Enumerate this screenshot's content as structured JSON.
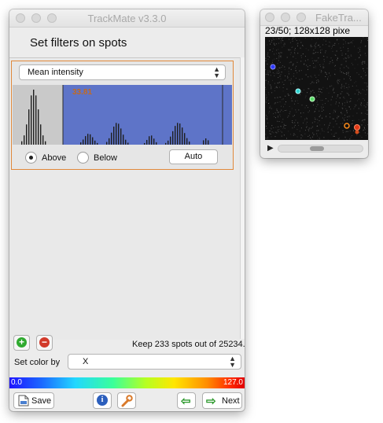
{
  "trackmate": {
    "title": "TrackMate v3.3.0",
    "heading": "Set filters on spots",
    "filter": {
      "feature": "Mean intensity",
      "threshold": "33.81",
      "above_label": "Above",
      "below_label": "Below",
      "auto_label": "Auto"
    },
    "keep_text": "Keep 233 spots out of  25234.",
    "set_color_label": "Set color by",
    "color_feature": "X",
    "colorbar": {
      "min": "0.0",
      "max": "127.0"
    },
    "buttons": {
      "save": "Save",
      "next": "Next"
    }
  },
  "faketracks": {
    "title": "FakeTra...",
    "info": "23/50; 128x128 pixe"
  },
  "colors": {
    "accent_orange": "#e0883a",
    "histogram_blue": "#5e74c8",
    "threshold_text": "#c46a1e"
  }
}
